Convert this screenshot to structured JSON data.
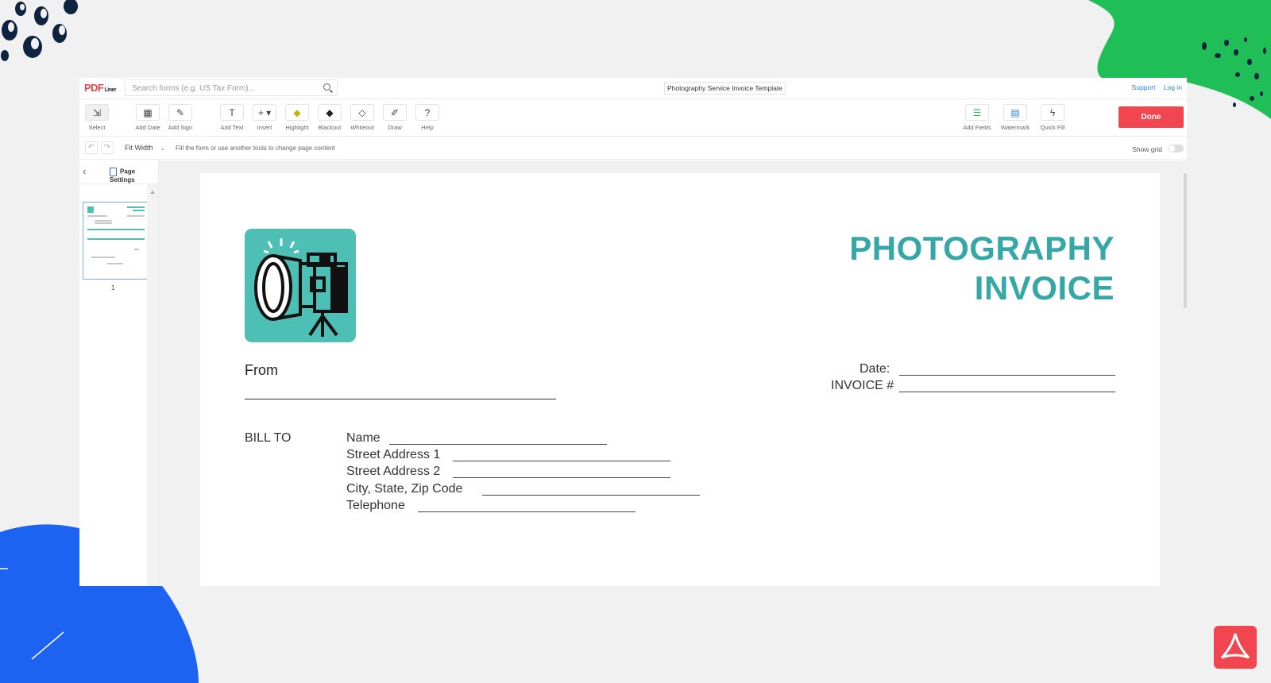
{
  "app": {
    "logo_main": "PDF",
    "logo_sub": "Liner",
    "search_placeholder": "Search forms (e.g. US Tax Form)...",
    "document_title": "Photography Service Invoice Template",
    "links": {
      "support": "Support",
      "login": "Log in"
    }
  },
  "toolbar": {
    "tools_left": [
      {
        "label": "Select",
        "icon": "cursor-icon"
      },
      {
        "label": "Add Date",
        "icon": "calendar-icon"
      },
      {
        "label": "Add Sign",
        "icon": "signature-icon"
      },
      {
        "label": "Add Text",
        "icon": "text-icon"
      },
      {
        "label": "Insert",
        "icon": "plus-icon"
      },
      {
        "label": "Highlight",
        "icon": "highlight-icon"
      },
      {
        "label": "Blackout",
        "icon": "blackout-icon"
      },
      {
        "label": "Whiteout",
        "icon": "whiteout-icon"
      },
      {
        "label": "Draw",
        "icon": "pen-icon"
      },
      {
        "label": "Help",
        "icon": "question-icon"
      }
    ],
    "tools_right": [
      {
        "label": "Add Fields",
        "icon": "fields-icon"
      },
      {
        "label": "Watermark",
        "icon": "watermark-icon"
      },
      {
        "label": "Quick Fill",
        "icon": "lightning-icon"
      }
    ],
    "done_label": "Done"
  },
  "subbar": {
    "zoom": "Fit Width",
    "hint": "Fill the form or use another tools to change page content",
    "show_grid_label": "Show grid"
  },
  "sidebar": {
    "page_settings_label": "Page Settings",
    "pages": [
      "1"
    ]
  },
  "document": {
    "title_line1": "PHOTOGRAPHY",
    "title_line2": "INVOICE",
    "from_label": "From",
    "date_label": "Date:",
    "invoice_label": "INVOICE #",
    "bill_to_label": "BILL TO",
    "bill_to_fields": [
      "Name",
      "Street Address 1",
      "Street Address 2",
      "City, State, Zip Code",
      "Telephone"
    ]
  },
  "colors": {
    "accent_teal": "#35a7a6",
    "camera_bg": "#4dbfb4",
    "done_red": "#f1464f",
    "deco_green": "#1fbe57",
    "deco_blue": "#1d63f2",
    "deco_navy": "#0e2340"
  }
}
